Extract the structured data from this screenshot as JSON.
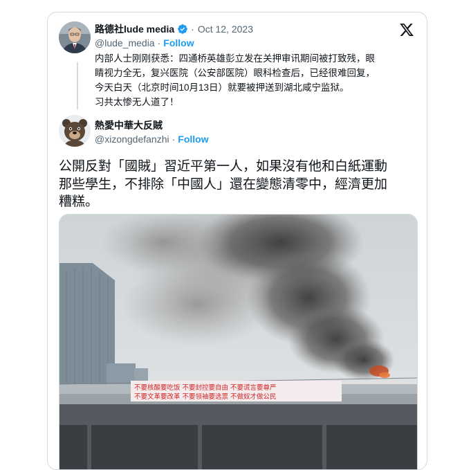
{
  "quoted_tweet": {
    "author_name": "路德社lude media",
    "separator": "·",
    "date": "Oct 12, 2023",
    "handle": "@lude_media",
    "handle_sep": "·",
    "follow_label": "Follow",
    "text_lines": [
      "内部人士刚刚获悉：四通桥英雄彭立发在关押审讯期间被打致残，眼",
      "睛视力全无，复兴医院（公安部医院）眼科检查后，已经很难回复，",
      "今天白天（北京时间10月13日）就要被押送到湖北咸宁监狱。",
      "习共太惨无人道了！"
    ]
  },
  "main_tweet": {
    "author_name": "熱愛中華大反賊",
    "handle": "@xizongdefanzhi",
    "handle_sep": "·",
    "follow_label": "Follow",
    "text_lines": [
      "公開反對「國賊」習近平第一人，如果沒有他和白紙運動",
      "那些學生，不排除「中國人」還在變態清零中，經濟更加",
      "糟糕。"
    ]
  },
  "banner_text": {
    "line1": "不要核酸要吃饭 不要封控要自由 不要谎言要尊严",
    "line2": "不要文革要改革 不要领袖要选票 不做奴才做公民"
  },
  "colors": {
    "accent": "#1d9bf0",
    "text": "#0f1419",
    "muted": "#536471",
    "border": "#cfd9de",
    "banner_bg": "#f4ecec",
    "banner_text": "#d0262a"
  },
  "icons": {
    "platform": "x-logo-icon",
    "verified": "verified-badge-icon"
  }
}
